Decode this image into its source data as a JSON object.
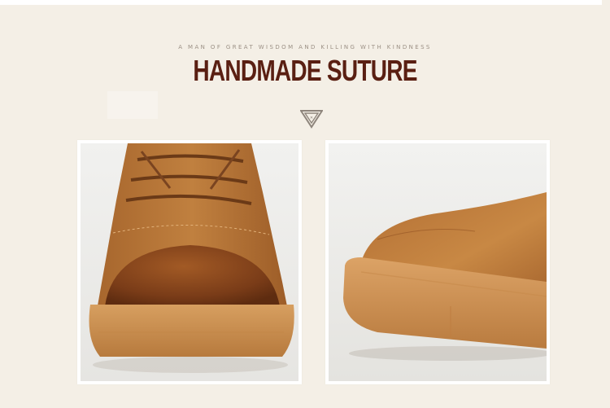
{
  "banner": {
    "tagline": "A MAN OF GREAT WISDOM AND KILLING WITH KINDNESS",
    "title": "HANDMADE SUTURE"
  },
  "colors": {
    "background": "#f4efe6",
    "title": "#5a1f12",
    "tagline": "#9b9085",
    "leather": "#b5733a",
    "sole": "#d49a5a"
  },
  "icons": {
    "divider": "inverted-triangle-icon"
  },
  "photos": [
    {
      "subject": "boot toe front view"
    },
    {
      "subject": "boot toe side view"
    }
  ]
}
